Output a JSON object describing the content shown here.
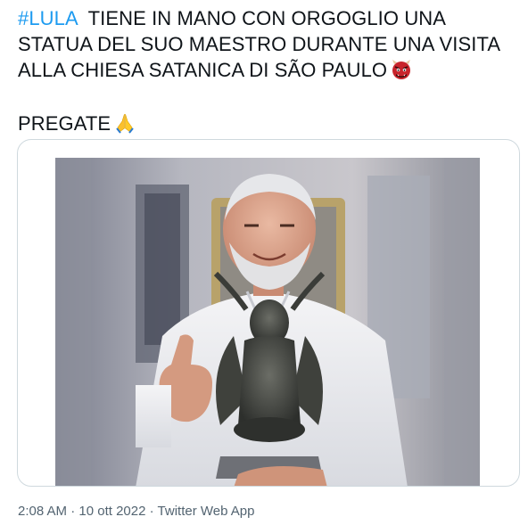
{
  "tweet": {
    "hashtag": "#LULA",
    "line1_rest": "  TIENE IN MANO CON ORGOGLIO UNA",
    "line2": "STATUA DEL SUO MAESTRO DURANTE UNA VISITA",
    "line3": "ALLA CHIESA SATANICA DI SÃO PAULO",
    "line3_emoji": "ogre-face-emoji",
    "line4": "PREGATE",
    "line4_emoji": "folded-hands-emoji"
  },
  "media": {
    "type": "photo",
    "description_icon": "photo-man-holding-baphomet-statue"
  },
  "meta": {
    "time": "2:08 AM",
    "separator1": " · ",
    "date": "10 ott 2022",
    "separator2": " · ",
    "source": "Twitter Web App"
  },
  "colors": {
    "hashtag": "#1d9bf0",
    "text": "#0f1419",
    "meta": "#536471",
    "border": "#cfd9de"
  }
}
